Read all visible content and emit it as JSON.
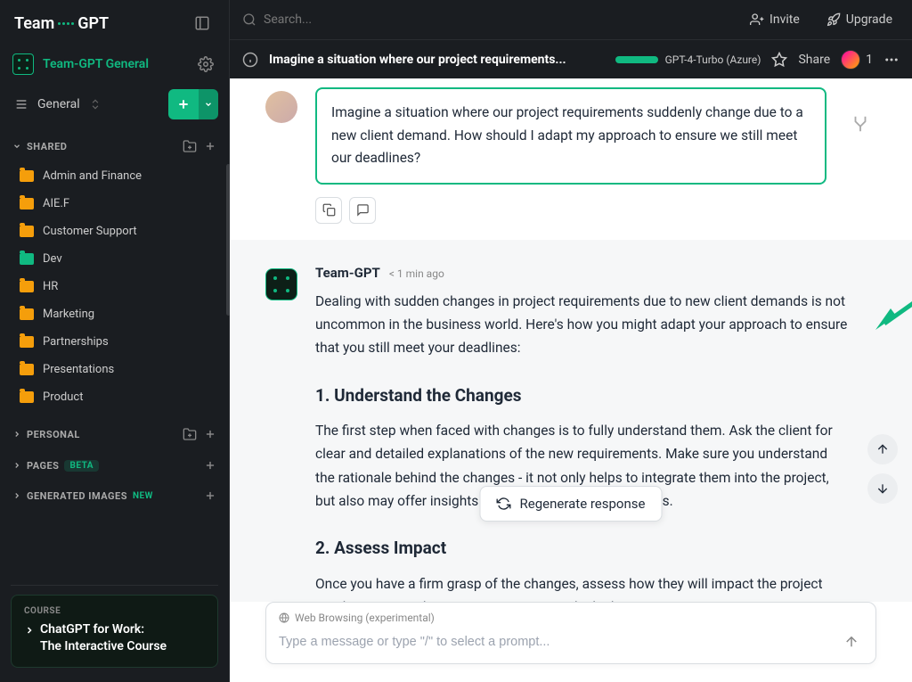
{
  "logo": {
    "pre": "Team",
    "post": "GPT"
  },
  "workspace": {
    "name": "Team-GPT General"
  },
  "general_label": "General",
  "sections": {
    "shared": "SHARED",
    "personal": "PERSONAL",
    "pages": "PAGES",
    "pages_badge": "BETA",
    "generated": "GENERATED IMAGES",
    "generated_badge": "NEW"
  },
  "folders": [
    {
      "name": "Admin and Finance",
      "color": "yellow"
    },
    {
      "name": "AIE.F",
      "color": "yellow"
    },
    {
      "name": "Customer Support",
      "color": "yellow"
    },
    {
      "name": "Dev",
      "color": "green"
    },
    {
      "name": "HR",
      "color": "yellow"
    },
    {
      "name": "Marketing",
      "color": "yellow"
    },
    {
      "name": "Partnerships",
      "color": "yellow"
    },
    {
      "name": "Presentations",
      "color": "yellow"
    },
    {
      "name": "Product",
      "color": "yellow"
    }
  ],
  "course": {
    "label": "COURSE",
    "title_line1": "ChatGPT for Work:",
    "title_line2": "The Interactive Course"
  },
  "topbar": {
    "search_placeholder": "Search...",
    "invite": "Invite",
    "upgrade": "Upgrade"
  },
  "chatbar": {
    "title": "Imagine a situation where our project requirements...",
    "model": "GPT-4-Turbo (Azure)",
    "share": "Share",
    "member_count": "1"
  },
  "user_message": "Imagine a situation where our project requirements suddenly change due to a new client demand. How should I adapt my approach to ensure we still meet our deadlines?",
  "assistant": {
    "name": "Team-GPT",
    "time": "< 1 min ago",
    "intro": "Dealing with sudden changes in project requirements due to new client demands is not uncommon in the business world. Here's how you might adapt your approach to ensure that you still meet your deadlines:",
    "h1": "1. Understand the Changes",
    "p1": "The first step when faced with changes is to fully understand them. Ask the client for clear and detailed explanations of the new requirements. Make sure you understand the rationale behind the changes - it not only helps to integrate them into the project, but also may offer insights to optimize other project areas.",
    "h2": "2. Assess Impact",
    "p2": "Once you have a firm grasp of the changes, assess how they will impact the project timeline, cost, and resources. Determine which changes are easy to"
  },
  "regen_label": "Regenerate response",
  "input": {
    "feature": "Web Browsing (experimental)",
    "placeholder": "Type a message or type \"/\" to select a prompt..."
  }
}
